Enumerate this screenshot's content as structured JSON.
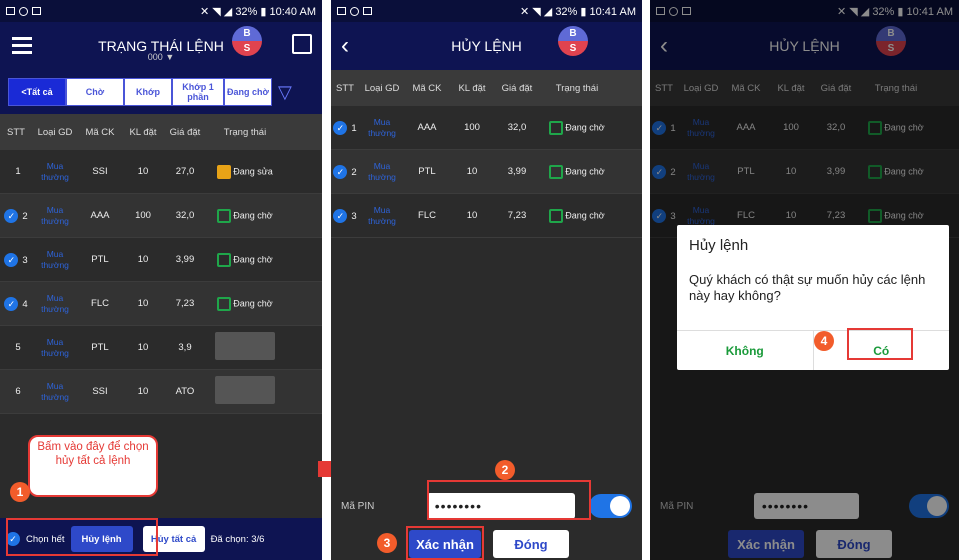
{
  "phone1": {
    "status": {
      "time": "10:40 AM",
      "battery": "32%"
    },
    "title": "TRẠNG THÁI LỆNH",
    "account": "000",
    "avatar": {
      "b": "B",
      "s": "S"
    },
    "tabs": [
      "<Tất cả",
      "Chờ",
      "Khớp",
      "Khớp 1 phần",
      "Đang chờ"
    ],
    "columns": [
      "STT",
      "Loại GD",
      "Mã CK",
      "KL đặt",
      "Giá đặt",
      "Trạng thái"
    ],
    "rows": [
      {
        "stt": "1",
        "type": "Mua thường",
        "code": "SSI",
        "qty": "10",
        "price": "27,0",
        "status": "Đang sửa",
        "checked": false
      },
      {
        "stt": "2",
        "type": "Mua thường",
        "code": "AAA",
        "qty": "100",
        "price": "32,0",
        "status": "Đang chờ",
        "checked": true
      },
      {
        "stt": "3",
        "type": "Mua thường",
        "code": "PTL",
        "qty": "10",
        "price": "3,99",
        "status": "Đang chờ",
        "checked": true
      },
      {
        "stt": "4",
        "type": "Mua thường",
        "code": "FLC",
        "qty": "10",
        "price": "7,23",
        "status": "Đang chờ",
        "checked": true
      },
      {
        "stt": "5",
        "type": "Mua thường",
        "code": "PTL",
        "qty": "10",
        "price": "3,9",
        "status": "",
        "checked": false
      },
      {
        "stt": "6",
        "type": "Mua thường",
        "code": "SSI",
        "qty": "10",
        "price": "ATO",
        "status": "",
        "checked": false
      }
    ],
    "callout": "Bấm vào đây để chọn hủy tất cả lệnh",
    "step1": "1",
    "bottom": {
      "select_all": "Chọn hết",
      "cancel_order": "Hủy lệnh",
      "cancel_all": "Hủy tất cả",
      "selected": "Đã chọn: 3/6"
    }
  },
  "phone2": {
    "status": {
      "time": "10:41 AM",
      "battery": "32%"
    },
    "title": "HỦY LỆNH",
    "avatar": {
      "b": "B",
      "s": "S"
    },
    "columns": [
      "STT",
      "Loại GD",
      "Mã CK",
      "KL đặt",
      "Giá đặt",
      "Trạng thái"
    ],
    "rows": [
      {
        "stt": "1",
        "type": "Mua thường",
        "code": "AAA",
        "qty": "100",
        "price": "32,0",
        "status": "Đang chờ"
      },
      {
        "stt": "2",
        "type": "Mua thường",
        "code": "PTL",
        "qty": "10",
        "price": "3,99",
        "status": "Đang chờ"
      },
      {
        "stt": "3",
        "type": "Mua thường",
        "code": "FLC",
        "qty": "10",
        "price": "7,23",
        "status": "Đang chờ"
      }
    ],
    "pin_label": "Mã PIN",
    "pin_value": "••••••••",
    "step2": "2",
    "step3": "3",
    "confirm": "Xác nhận",
    "close": "Đóng"
  },
  "phone3": {
    "status": {
      "time": "10:41 AM",
      "battery": "32%"
    },
    "title": "HỦY LỆNH",
    "avatar": {
      "b": "B",
      "s": "S"
    },
    "columns": [
      "STT",
      "Loại GD",
      "Mã CK",
      "KL đặt",
      "Giá đặt",
      "Trạng thái"
    ],
    "rows": [
      {
        "stt": "1",
        "type": "Mua thường",
        "code": "AAA",
        "qty": "100",
        "price": "32,0",
        "status": "Đang chờ"
      },
      {
        "stt": "2",
        "type": "Mua thường",
        "code": "PTL",
        "qty": "10",
        "price": "3,99",
        "status": "Đang chờ"
      },
      {
        "stt": "3",
        "type": "Mua thường",
        "code": "FLC",
        "qty": "10",
        "price": "7,23",
        "status": "Đang chờ"
      }
    ],
    "pin_label": "Mã PIN",
    "pin_value": "••••••••",
    "confirm": "Xác nhận",
    "close": "Đóng",
    "dialog": {
      "title": "Hủy lệnh",
      "message": "Quý khách có thật sự muốn hủy các lệnh này hay không?",
      "no": "Không",
      "yes": "Có"
    },
    "step4": "4"
  }
}
